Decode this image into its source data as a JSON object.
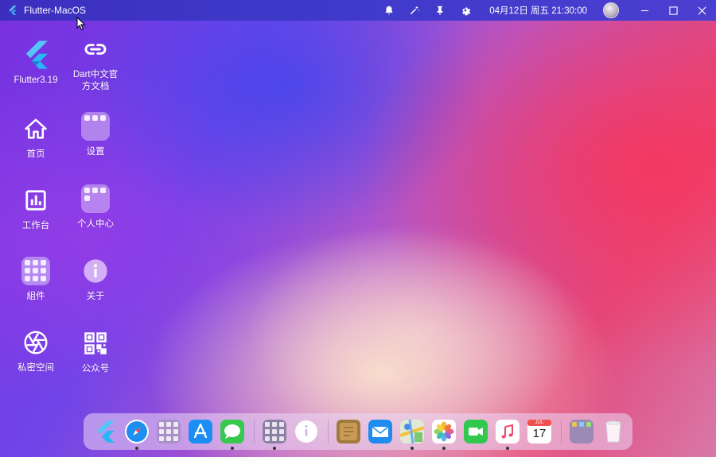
{
  "window": {
    "title": "Flutter-MacOS",
    "datetime": "04月12日 周五 21:30:00"
  },
  "titlebar_icons": [
    "bell-icon",
    "magic-wand-icon",
    "pin-icon",
    "settings-gear-icon"
  ],
  "desktop": {
    "items": [
      {
        "label": "Flutter3.19",
        "icon": "flutter-logo-icon"
      },
      {
        "label": "Dart中文官方文档",
        "icon": "link-icon"
      },
      {
        "label": "首页",
        "icon": "home-icon"
      },
      {
        "label": "设置",
        "icon": "settings-tile-icon"
      },
      {
        "label": "工作台",
        "icon": "bar-chart-icon"
      },
      {
        "label": "个人中心",
        "icon": "profile-tile-icon"
      },
      {
        "label": "組件",
        "icon": "components-tile-icon"
      },
      {
        "label": "关于",
        "icon": "info-icon"
      },
      {
        "label": "私密空间",
        "icon": "camera-aperture-icon"
      },
      {
        "label": "公众号",
        "icon": "qr-code-icon"
      }
    ]
  },
  "dock": {
    "items": [
      {
        "name": "flutter",
        "running": false
      },
      {
        "name": "safari",
        "running": true
      },
      {
        "name": "launchpad",
        "running": false
      },
      {
        "name": "app-store",
        "running": false
      },
      {
        "name": "messages",
        "running": true
      },
      {
        "name": "components",
        "running": true
      },
      {
        "name": "info",
        "running": false
      },
      {
        "name": "notes",
        "running": false
      },
      {
        "name": "mail",
        "running": false
      },
      {
        "name": "maps",
        "running": true
      },
      {
        "name": "photos",
        "running": true
      },
      {
        "name": "facetime",
        "running": false
      },
      {
        "name": "music",
        "running": true
      },
      {
        "name": "calendar",
        "running": false
      },
      {
        "name": "folder",
        "running": false
      },
      {
        "name": "trash",
        "running": false
      }
    ],
    "calendar": {
      "month": "JUL",
      "day": "17"
    }
  },
  "colors": {
    "titlebar": "#3c2fbf",
    "accent_pink": "#f5375f",
    "accent_purple": "#7a2fe0"
  }
}
